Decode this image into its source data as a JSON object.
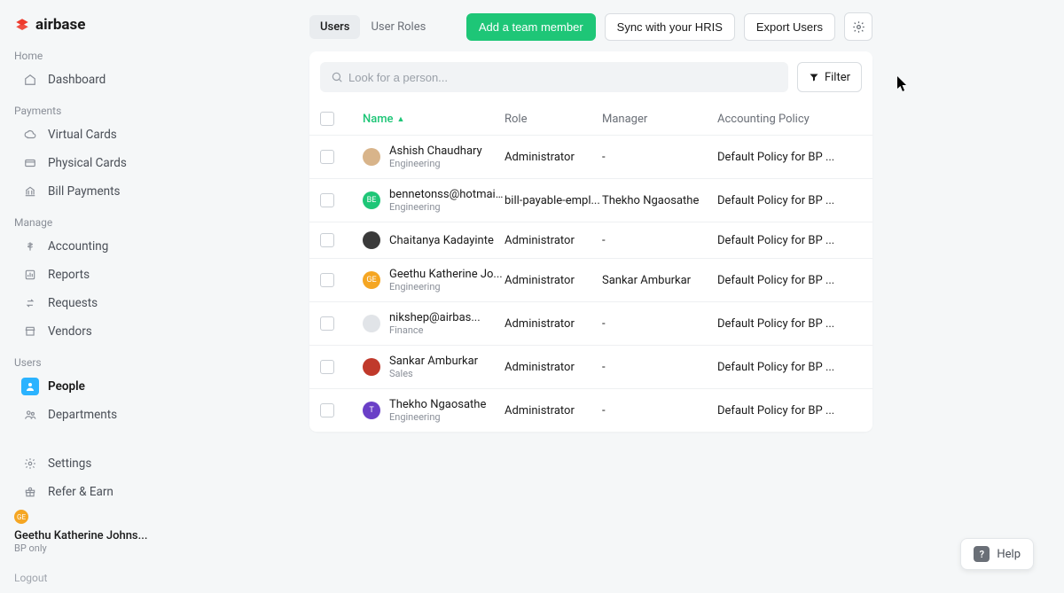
{
  "brand": "airbase",
  "sidebar": {
    "sections": {
      "home": {
        "heading": "Home",
        "items": [
          {
            "label": "Dashboard"
          }
        ]
      },
      "payments": {
        "heading": "Payments",
        "items": [
          {
            "label": "Virtual Cards"
          },
          {
            "label": "Physical Cards"
          },
          {
            "label": "Bill Payments"
          }
        ]
      },
      "manage": {
        "heading": "Manage",
        "items": [
          {
            "label": "Accounting"
          },
          {
            "label": "Reports"
          },
          {
            "label": "Requests"
          },
          {
            "label": "Vendors"
          }
        ]
      },
      "users": {
        "heading": "Users",
        "items": [
          {
            "label": "People"
          },
          {
            "label": "Departments"
          }
        ]
      }
    },
    "footer": {
      "settings": "Settings",
      "refer": "Refer & Earn"
    },
    "user": {
      "avatar_initials": "GE",
      "name": "Geethu Katherine Johns...",
      "sub": "BP only",
      "logout": "Logout"
    }
  },
  "topbar": {
    "tabs": [
      {
        "label": "Users"
      },
      {
        "label": "User Roles"
      }
    ],
    "add_button": "Add a team member",
    "sync_button": "Sync with your HRIS",
    "export_button": "Export Users"
  },
  "search": {
    "placeholder": "Look for a person...",
    "filter_label": "Filter"
  },
  "table": {
    "headers": {
      "name": "Name",
      "role": "Role",
      "manager": "Manager",
      "policy": "Accounting Policy"
    },
    "rows": [
      {
        "name": "Ashish Chaudhary",
        "dept": "Engineering",
        "role": "Administrator",
        "manager": "-",
        "policy": "Default Policy for BP ...",
        "avatar_bg": "#d8b48a",
        "avatar_text": ""
      },
      {
        "name": "bennetonss@hotmail....",
        "dept": "Engineering",
        "role": "bill-payable-empl...",
        "manager": "Thekho Ngaosathe",
        "policy": "Default Policy for BP ...",
        "avatar_bg": "#1ec677",
        "avatar_text": "BE"
      },
      {
        "name": "Chaitanya Kadayinte",
        "dept": "",
        "role": "Administrator",
        "manager": "-",
        "policy": "Default Policy for BP ...",
        "avatar_bg": "#3a3a3a",
        "avatar_text": ""
      },
      {
        "name": "Geethu Katherine Jo...",
        "dept": "Engineering",
        "role": "Administrator",
        "manager": "Sankar Amburkar",
        "policy": "Default Policy for BP ...",
        "avatar_bg": "#f5a623",
        "avatar_text": "GE"
      },
      {
        "name": "nikshep@airbas...",
        "dept": "Finance",
        "role": "Administrator",
        "manager": "-",
        "policy": "Default Policy for BP ...",
        "avatar_bg": "#e1e4e8",
        "avatar_text": ""
      },
      {
        "name": "Sankar Amburkar",
        "dept": "Sales",
        "role": "Administrator",
        "manager": "-",
        "policy": "Default Policy for BP ...",
        "avatar_bg": "#c0392b",
        "avatar_text": ""
      },
      {
        "name": "Thekho Ngaosathe",
        "dept": "Engineering",
        "role": "Administrator",
        "manager": "-",
        "policy": "Default Policy for BP ...",
        "avatar_bg": "#6a3fc7",
        "avatar_text": "T"
      }
    ]
  },
  "help_label": "Help"
}
